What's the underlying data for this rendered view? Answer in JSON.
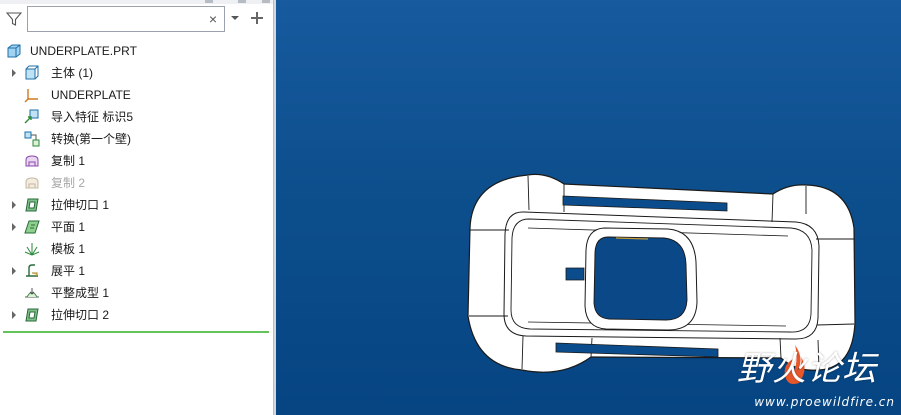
{
  "search": {
    "value": "",
    "placeholder": "",
    "clear_glyph": "×"
  },
  "tree": {
    "root": {
      "label": "UNDERPLATE.PRT",
      "icon": "part-icon"
    },
    "items": [
      {
        "label": "主体 (1)",
        "icon": "body-icon",
        "expandable": true,
        "disabled": false
      },
      {
        "label": "UNDERPLATE",
        "icon": "csys-icon",
        "expandable": false,
        "disabled": false
      },
      {
        "label": "导入特征 标识5",
        "icon": "import-feature-icon",
        "expandable": false,
        "disabled": false
      },
      {
        "label": "转换(第一个壁)",
        "icon": "convert-icon",
        "expandable": false,
        "disabled": false
      },
      {
        "label": "复制 1",
        "icon": "copy-icon",
        "expandable": false,
        "disabled": false
      },
      {
        "label": "复制 2",
        "icon": "copy-icon",
        "expandable": false,
        "disabled": true
      },
      {
        "label": "拉伸切口 1",
        "icon": "extrude-cut-icon",
        "expandable": true,
        "disabled": false
      },
      {
        "label": "平面 1",
        "icon": "plane-icon",
        "expandable": true,
        "disabled": false
      },
      {
        "label": "模板 1",
        "icon": "form-icon",
        "expandable": false,
        "disabled": false
      },
      {
        "label": "展平 1",
        "icon": "flatten-icon",
        "expandable": true,
        "disabled": false
      },
      {
        "label": "平整成型 1",
        "icon": "flat-form-icon",
        "expandable": false,
        "disabled": false
      },
      {
        "label": "拉伸切口 2",
        "icon": "extrude-cut-icon",
        "expandable": true,
        "disabled": false
      }
    ]
  },
  "viewport": {
    "background_top": "#175a9e",
    "background_bottom": "#064482",
    "model_fill": "#ffffff",
    "model_edge": "#1a1a1a"
  },
  "watermark": {
    "title": "野火论坛",
    "url": "www.proewildfire.cn",
    "accent": "#e8572a"
  },
  "colors": {
    "insert_line": "#63c35a"
  }
}
